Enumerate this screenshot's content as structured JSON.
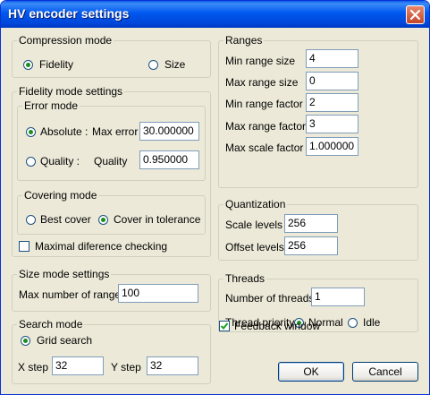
{
  "window": {
    "title": "HV encoder settings"
  },
  "compression_mode": {
    "label": "Compression mode",
    "fidelity": "Fidelity",
    "size": "Size",
    "selected": "Fidelity"
  },
  "fidelity_settings": {
    "label": "Fidelity mode settings",
    "error_mode": {
      "label": "Error mode",
      "absolute": "Absolute :",
      "max_error_label": "Max error",
      "max_error_value": "30.000000",
      "quality_radio": "Quality :",
      "quality_label": "Quality",
      "quality_value": "0.950000",
      "selected": "Absolute"
    },
    "covering_mode": {
      "label": "Covering mode",
      "best_cover": "Best cover",
      "cover_in_tolerance": "Cover in tolerance",
      "selected": "Cover in tolerance"
    },
    "maximal_difference": "Maximal diference checking",
    "maximal_difference_checked": false
  },
  "size_settings": {
    "label": "Size mode settings",
    "max_ranges_label": "Max number of ranges",
    "max_ranges_value": "100"
  },
  "search_mode": {
    "label": "Search mode",
    "grid_search": "Grid search",
    "x_step_label": "X step",
    "x_step_value": "32",
    "y_step_label": "Y step",
    "y_step_value": "32"
  },
  "ranges": {
    "label": "Ranges",
    "min_range_size_label": "Min range size",
    "min_range_size_value": "4",
    "max_range_size_label": "Max range size",
    "max_range_size_value": "0",
    "min_range_factor_label": "Min range factor",
    "min_range_factor_value": "2",
    "max_range_factor_label": "Max range factor",
    "max_range_factor_value": "3",
    "max_scale_factor_label": "Max scale factor",
    "max_scale_factor_value": "1.000000"
  },
  "quantization": {
    "label": "Quantization",
    "scale_levels_label": "Scale levels",
    "scale_levels_value": "256",
    "offset_levels_label": "Offset levels",
    "offset_levels_value": "256"
  },
  "threads": {
    "label": "Threads",
    "number_label": "Number of threads",
    "number_value": "1",
    "priority_label": "Thread priority",
    "normal": "Normal",
    "idle": "Idle",
    "selected": "Normal"
  },
  "feedback_window": {
    "label": "Feedback window",
    "checked": true
  },
  "buttons": {
    "ok": "OK",
    "cancel": "Cancel"
  },
  "colors": {
    "title_bar": "#0058ee",
    "dialog_bg": "#ece9d8",
    "close_button": "#c2462a"
  }
}
